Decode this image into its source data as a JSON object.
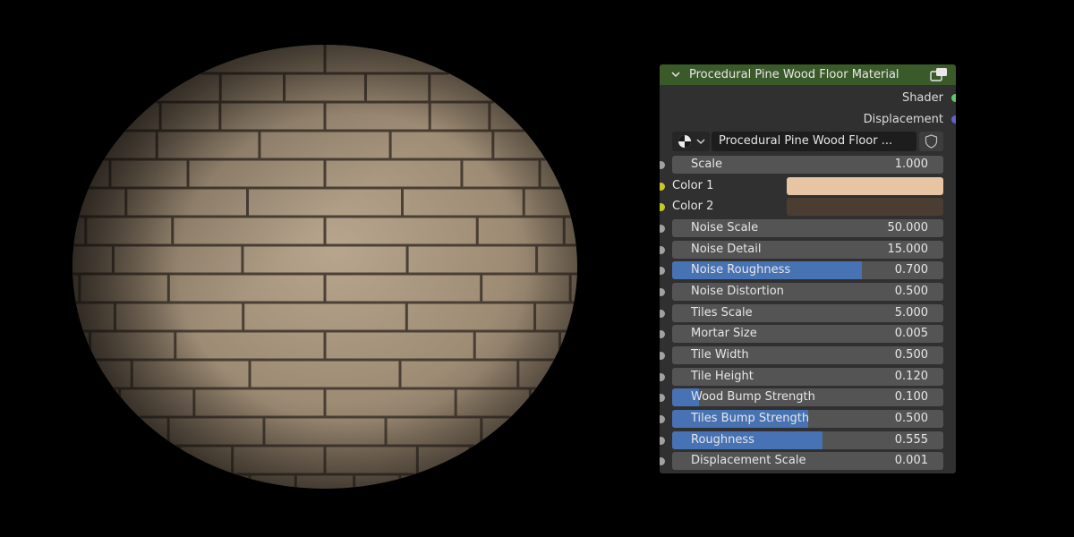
{
  "node": {
    "title": "Procedural Pine Wood Floor Material",
    "header_color": "#3b5a29",
    "outputs": [
      {
        "label": "Shader",
        "socket_color": "#63c763"
      },
      {
        "label": "Displacement",
        "socket_color": "#6363c7"
      }
    ],
    "group_name": "Procedural Pine Wood Floor ...",
    "inputs": [
      {
        "label": "Scale",
        "value": "1.000",
        "fill": 0
      },
      {
        "label": "Color 1",
        "color": "#e6c4a4"
      },
      {
        "label": "Color 2",
        "color": "#4a3d31"
      },
      {
        "label": "Noise Scale",
        "value": "50.000",
        "fill": 0
      },
      {
        "label": "Noise Detail",
        "value": "15.000",
        "fill": 0
      },
      {
        "label": "Noise Roughness",
        "value": "0.700",
        "fill": 0.7
      },
      {
        "label": "Noise Distortion",
        "value": "0.500",
        "fill": 0
      },
      {
        "label": "Tiles Scale",
        "value": "5.000",
        "fill": 0
      },
      {
        "label": "Mortar Size",
        "value": "0.005",
        "fill": 0
      },
      {
        "label": "Tile Width",
        "value": "0.500",
        "fill": 0
      },
      {
        "label": "Tile Height",
        "value": "0.120",
        "fill": 0
      },
      {
        "label": "Wood Bump Strength",
        "value": "0.100",
        "fill": 0.1
      },
      {
        "label": "Tiles Bump Strength",
        "value": "0.500",
        "fill": 0.5
      },
      {
        "label": "Roughness",
        "value": "0.555",
        "fill": 0.555
      },
      {
        "label": "Displacement Scale",
        "value": "0.001",
        "fill": 0
      }
    ]
  },
  "colors": {
    "socket_float": "#a1a1a1",
    "socket_color": "#c7c729",
    "slider_fill": "#4772b3",
    "field_bg": "#545454",
    "node_bg": "#303030"
  },
  "icons": [
    "collapse-chevron-icon",
    "node-group-icon",
    "material-ball-icon",
    "chevron-down-icon",
    "fake-user-shield-icon"
  ]
}
